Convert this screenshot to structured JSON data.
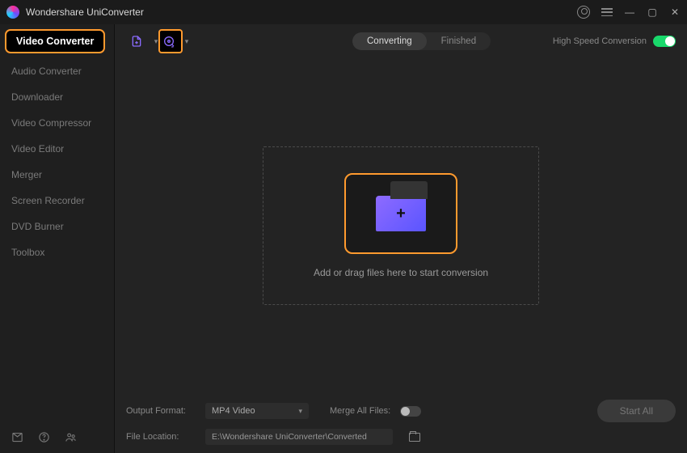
{
  "app": {
    "title": "Wondershare UniConverter"
  },
  "sidebar": {
    "items": [
      {
        "label": "Video Converter",
        "active": true
      },
      {
        "label": "Audio Converter"
      },
      {
        "label": "Downloader"
      },
      {
        "label": "Video Compressor"
      },
      {
        "label": "Video Editor"
      },
      {
        "label": "Merger"
      },
      {
        "label": "Screen Recorder"
      },
      {
        "label": "DVD Burner"
      },
      {
        "label": "Toolbox"
      }
    ]
  },
  "toolbar": {
    "tabs": [
      {
        "label": "Converting",
        "active": true
      },
      {
        "label": "Finished"
      }
    ],
    "high_speed_label": "High Speed Conversion",
    "high_speed_on": true
  },
  "dropzone": {
    "text": "Add or drag files here to start conversion"
  },
  "footer": {
    "output_format_label": "Output Format:",
    "output_format_value": "MP4 Video",
    "merge_label": "Merge All Files:",
    "merge_on": false,
    "file_location_label": "File Location:",
    "file_location_value": "E:\\Wondershare UniConverter\\Converted",
    "start_label": "Start All"
  }
}
